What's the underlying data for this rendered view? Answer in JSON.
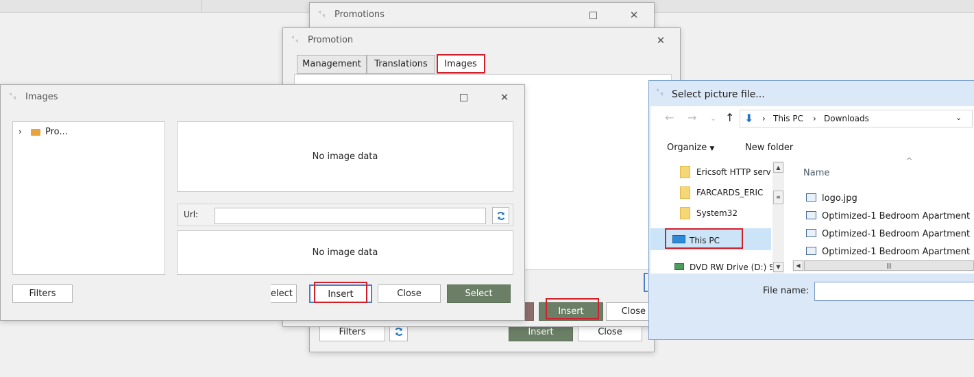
{
  "promotions_window": {
    "title": "Promotions",
    "filters_label": "Filters",
    "insert_label": "Insert",
    "close_label": "Close"
  },
  "promotion_window": {
    "title": "Promotion",
    "tabs": [
      "Management",
      "Translations",
      "Images"
    ],
    "insert_label": "Insert",
    "close_label": "Close"
  },
  "images_window": {
    "title": "Images",
    "tree_item": "Pro...",
    "no_image_text_top": "No image data",
    "url_label": "Url:",
    "url_value": "",
    "no_image_text_bottom": "No image data",
    "filters_label": "Filters",
    "select_partial_label": "elect",
    "insert_label": "Insert",
    "close_label": "Close",
    "select_label": "Select"
  },
  "file_dialog": {
    "title": "Select picture file...",
    "breadcrumb": [
      "This PC",
      "Downloads"
    ],
    "organize_label": "Organize",
    "new_folder_label": "New folder",
    "nav_items": [
      "Ericsoft HTTP serv",
      "FARCARDS_ERIC",
      "System32",
      "This PC",
      "DVD RW Drive (D:) S"
    ],
    "column_name": "Name",
    "files": [
      "logo.jpg",
      "Optimized-1 Bedroom Apartment",
      "Optimized-1 Bedroom Apartment",
      "Optimized-1 Bedroom Apartment"
    ],
    "file_name_label": "File name:",
    "file_name_value": ""
  },
  "colors": {
    "accent_green": "#6b7f66",
    "highlight_red": "#d0202b",
    "selection_blue": "#cce4f7"
  }
}
